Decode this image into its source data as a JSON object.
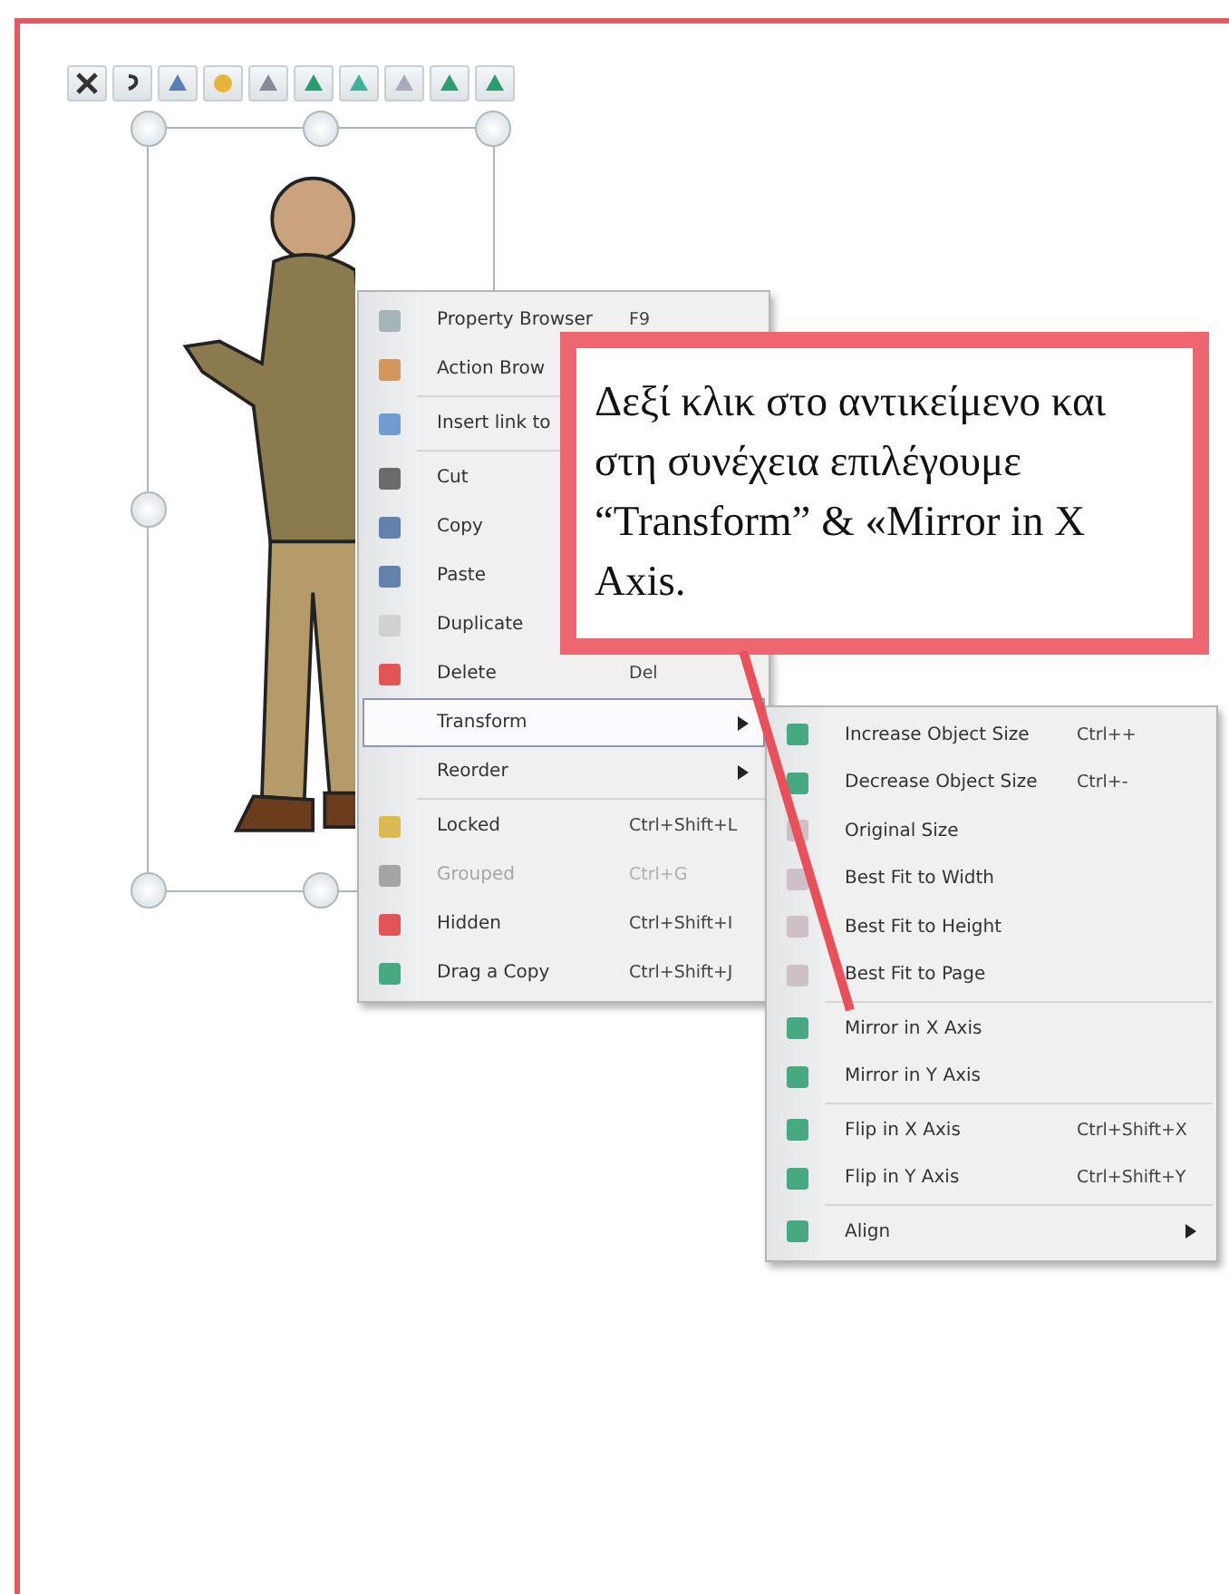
{
  "context_menu": {
    "items": [
      {
        "kind": "item",
        "label": "Property Browser",
        "shortcut": "F9",
        "selected": false,
        "disabled": false
      },
      {
        "kind": "item",
        "label": "Action Brow",
        "selected": false,
        "disabled": false
      },
      {
        "kind": "separator"
      },
      {
        "kind": "item",
        "label": "Insert link to",
        "selected": false,
        "disabled": false
      },
      {
        "kind": "separator"
      },
      {
        "kind": "item",
        "label": "Cut",
        "selected": false,
        "disabled": false
      },
      {
        "kind": "item",
        "label": "Copy",
        "selected": false,
        "disabled": false
      },
      {
        "kind": "item",
        "label": "Paste",
        "selected": false,
        "disabled": false
      },
      {
        "kind": "item",
        "label": "Duplicate",
        "selected": false,
        "disabled": false
      },
      {
        "kind": "item",
        "label": "Delete",
        "shortcut": "Del",
        "selected": false,
        "disabled": false
      },
      {
        "kind": "submenu",
        "label": "Transform",
        "selected": true,
        "disabled": false
      },
      {
        "kind": "submenu",
        "label": "Reorder",
        "selected": false,
        "disabled": false
      },
      {
        "kind": "separator"
      },
      {
        "kind": "item",
        "label": "Locked",
        "shortcut": "Ctrl+Shift+L",
        "selected": false,
        "disabled": false
      },
      {
        "kind": "item",
        "label": "Grouped",
        "shortcut": "Ctrl+G",
        "selected": false,
        "disabled": true
      },
      {
        "kind": "item",
        "label": "Hidden",
        "shortcut": "Ctrl+Shift+I",
        "selected": false,
        "disabled": false
      },
      {
        "kind": "item",
        "label": "Drag a Copy",
        "shortcut": "Ctrl+Shift+J",
        "selected": false,
        "disabled": false
      }
    ]
  },
  "transform_submenu": {
    "items": [
      {
        "kind": "item",
        "label": "Increase Object Size",
        "shortcut": "Ctrl++"
      },
      {
        "kind": "item",
        "label": "Decrease Object Size",
        "shortcut": "Ctrl+-"
      },
      {
        "kind": "item",
        "label": "Original Size"
      },
      {
        "kind": "item",
        "label": "Best Fit to Width"
      },
      {
        "kind": "item",
        "label": "Best Fit to Height"
      },
      {
        "kind": "item",
        "label": "Best Fit to Page"
      },
      {
        "kind": "separator"
      },
      {
        "kind": "item",
        "label": "Mirror in X Axis"
      },
      {
        "kind": "item",
        "label": "Mirror in Y Axis"
      },
      {
        "kind": "separator"
      },
      {
        "kind": "item",
        "label": "Flip in X Axis",
        "shortcut": "Ctrl+Shift+X"
      },
      {
        "kind": "item",
        "label": "Flip in Y Axis",
        "shortcut": "Ctrl+Shift+Y"
      },
      {
        "kind": "separator"
      },
      {
        "kind": "submenu",
        "label": "Align"
      }
    ]
  },
  "callout": {
    "text": "Δεξί κλικ στο αντικείμενο και στη συνέχεια επιλέγουμε “Transform” & «Mirror in X Axis."
  }
}
